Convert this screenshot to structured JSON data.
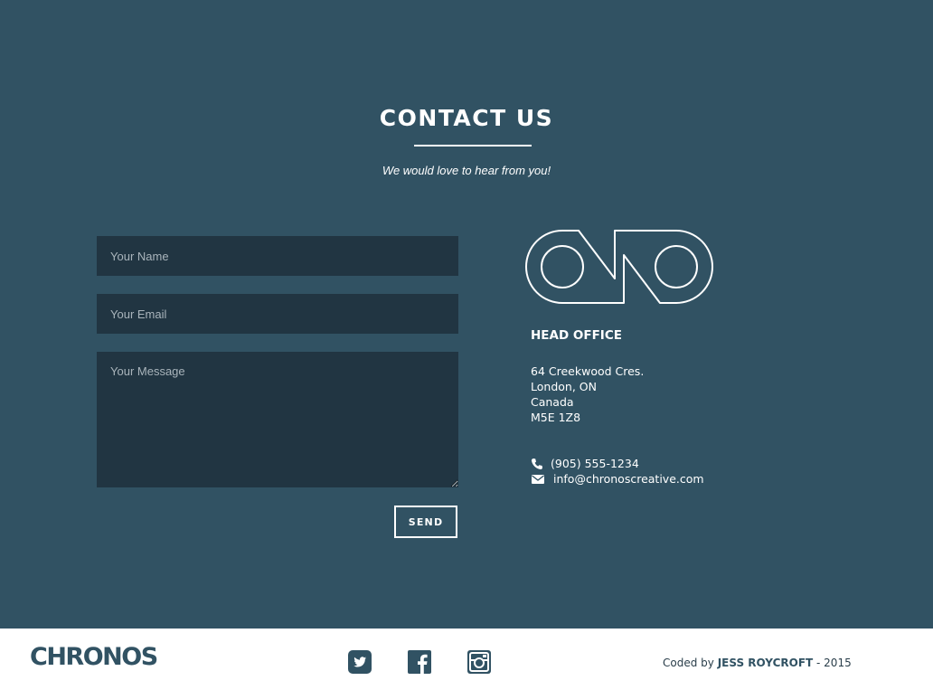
{
  "contact": {
    "title": "CONTACT US",
    "subtitle": "We would love to hear from you!",
    "form": {
      "name_placeholder": "Your Name",
      "email_placeholder": "Your Email",
      "message_placeholder": "Your Message",
      "send_label": "SEND"
    },
    "office": {
      "logo_icon": "ono-logo",
      "heading": "HEAD OFFICE",
      "address": [
        "64 Creekwood Cres.",
        "London, ON",
        "Canada",
        "M5E 1Z8"
      ],
      "phone": "(905) 555-1234",
      "phone_icon": "phone-icon",
      "email": "info@chronoscreative.com",
      "email_icon": "envelope-icon"
    }
  },
  "footer": {
    "logo_text": "CHRONOS",
    "social": [
      {
        "name": "twitter",
        "icon": "twitter-icon"
      },
      {
        "name": "facebook",
        "icon": "facebook-icon"
      },
      {
        "name": "instagram",
        "icon": "instagram-icon"
      }
    ],
    "credit_prefix": "Coded by",
    "credit_author": "JESS ROYCROFT",
    "credit_suffix": "- 2015"
  },
  "colors": {
    "background": "#315263",
    "field_background": "#213542",
    "text_light": "#ffffff",
    "footer_background": "#ffffff",
    "brand": "#315263"
  }
}
